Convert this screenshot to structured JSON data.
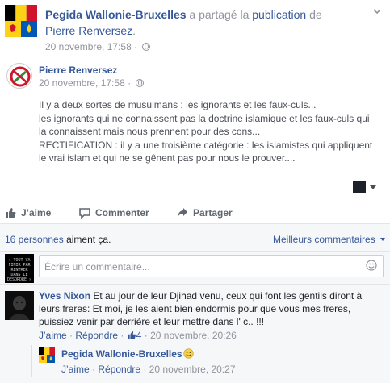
{
  "share": {
    "page_name": "Pegida Wallonie-Bruxelles",
    "text_mid": " a partagé la ",
    "publication_link": "publication",
    "text_of": " de",
    "origin_name": "Pierre Renversez",
    "period": ".",
    "timestamp": "20 novembre, 17:58",
    "separator": " · "
  },
  "post": {
    "author": "Pierre Renversez",
    "timestamp": "20 novembre, 17:58",
    "separator": " · ",
    "lines": [
      "Il y a deux sortes de musulmans : les ignorants et les faux-culs...",
      "les ignorants qui ne connaissent pas la doctrine islamique et les faux-culs qui",
      "la connaissent mais nous prennent pour des cons...",
      "RECTIFICATION : il y a une troisième catégorie : les islamistes qui appliquent",
      "le vrai islam et qui ne se gênent pas pour nous le prouver...."
    ]
  },
  "actions": {
    "like": "J’aime",
    "comment": "Commenter",
    "share": "Partager"
  },
  "likes": {
    "count_link": "16 personnes",
    "suffix": " aiment ça.",
    "best_comments": "Meilleurs commentaires"
  },
  "composer": {
    "placeholder": "Écrire un commentaire...",
    "avatar_text": "« TOUT VA FINIR PAR RENTRER DANS LE DÉSORDRE »"
  },
  "comments": [
    {
      "author": "Yves Nixon",
      "lines": [
        " Et au jour de leur Djihad venu, ceux qui font les gentils diront à",
        "leurs freres: Et moi, je les aient bien endormis pour que vous mes freres,",
        "puissiez venir par derrière et leur mettre dans l' c.. !!!"
      ],
      "like": "J’aime",
      "reply": "Répondre",
      "like_count": "4",
      "timestamp": "20 novembre, 20:26",
      "separator": " · "
    }
  ],
  "replies": [
    {
      "author": "Pegida Wallonie-Bruxelles",
      "like": "J’aime",
      "reply": "Répondre",
      "timestamp": "20 novembre, 20:27",
      "separator": " · "
    }
  ],
  "colors": {
    "link": "#365899",
    "meta": "#90949c",
    "flag_black": "#000000",
    "flag_yellow": "#fcd116",
    "flag_red": "#cf142b"
  }
}
